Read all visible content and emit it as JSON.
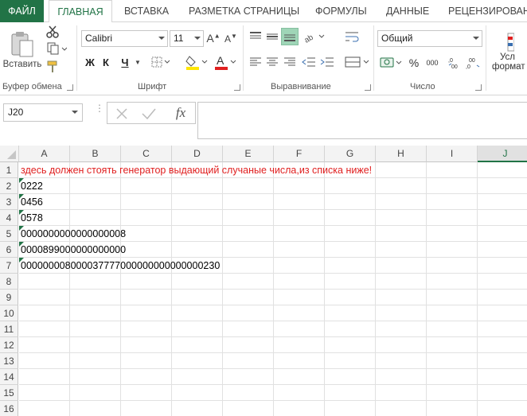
{
  "tabs": [
    "ФАЙЛ",
    "ГЛАВНАЯ",
    "ВСТАВКА",
    "РАЗМЕТКА СТРАНИЦЫ",
    "ФОРМУЛЫ",
    "ДАННЫЕ",
    "РЕЦЕНЗИРОВАНИ"
  ],
  "ribbon": {
    "clipboard": {
      "paste_label": "Вставить",
      "group_label": "Буфер обмена"
    },
    "font": {
      "name": "Calibri",
      "size": "11",
      "bold": "Ж",
      "italic": "К",
      "underline": "Ч",
      "group_label": "Шрифт"
    },
    "alignment": {
      "group_label": "Выравнивание"
    },
    "number": {
      "format": "Общий",
      "percent": "%",
      "thousands": "000",
      "group_label": "Число"
    },
    "styles": {
      "line1": "Усл",
      "line2": "формат"
    }
  },
  "formula_bar": {
    "name_box": "J20",
    "fx": "fx",
    "formula": ""
  },
  "columns": [
    "A",
    "B",
    "C",
    "D",
    "E",
    "F",
    "G",
    "H",
    "I",
    "J"
  ],
  "selected_column": "J",
  "rows": [
    "1",
    "2",
    "3",
    "4",
    "5",
    "6",
    "7",
    "8",
    "9",
    "10",
    "11",
    "12",
    "13",
    "14",
    "15",
    "16"
  ],
  "cells": {
    "A1": "здесь должен стоять генератор выдающий случаные числа,из списка ниже!",
    "A2": "0222",
    "A3": "0456",
    "A4": "0578",
    "A5": "0000000000000000008",
    "A6": "0000899000000000000",
    "A7": "000000008000037777000000000000000230"
  },
  "colors": {
    "accent": "#217346",
    "warning_text": "#e02020"
  }
}
